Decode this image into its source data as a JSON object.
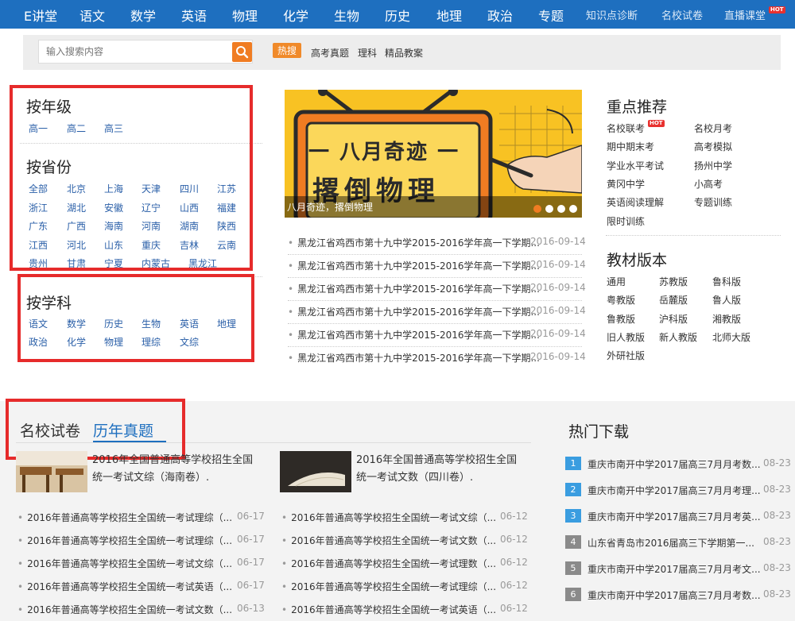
{
  "nav": {
    "brand": "E讲堂",
    "subjects": [
      "语文",
      "数学",
      "英语",
      "物理",
      "化学",
      "生物",
      "历史",
      "地理",
      "政治",
      "专题"
    ],
    "extras": [
      "知识点诊断",
      "名校试卷",
      "直播课堂"
    ],
    "hot_badge": "HOT"
  },
  "search": {
    "placeholder": "输入搜索内容",
    "hot_label": "热搜",
    "hot_links": [
      "高考真题",
      "理科",
      "精品教案"
    ]
  },
  "by_grade": {
    "title": "按年级",
    "items": [
      "高一",
      "高二",
      "高三"
    ]
  },
  "by_province": {
    "title": "按省份",
    "items": [
      "全部",
      "北京",
      "上海",
      "天津",
      "四川",
      "江苏",
      "浙江",
      "湖北",
      "安徽",
      "辽宁",
      "山西",
      "福建",
      "广东",
      "广西",
      "海南",
      "河南",
      "湖南",
      "陕西",
      "江西",
      "河北",
      "山东",
      "重庆",
      "吉林",
      "云南",
      "贵州",
      "甘肃",
      "宁夏",
      "内蒙古",
      "黑龙江"
    ]
  },
  "by_subject": {
    "title": "按学科",
    "items": [
      "语文",
      "数学",
      "历史",
      "生物",
      "英语",
      "地理",
      "政治",
      "化学",
      "物理",
      "理综",
      "文综"
    ]
  },
  "banner": {
    "headline": "一 八月奇迹 一",
    "subhead": "撂倒物理",
    "caption": "八月奇迹，撂倒物理"
  },
  "news": {
    "items": [
      {
        "title": "黑龙江省鸡西市第十九中学2015-2016学年高一下学期...",
        "date": "2016-09-14"
      },
      {
        "title": "黑龙江省鸡西市第十九中学2015-2016学年高一下学期...",
        "date": "2016-09-14"
      },
      {
        "title": "黑龙江省鸡西市第十九中学2015-2016学年高一下学期...",
        "date": "2016-09-14"
      },
      {
        "title": "黑龙江省鸡西市第十九中学2015-2016学年高一下学期...",
        "date": "2016-09-14"
      },
      {
        "title": "黑龙江省鸡西市第十九中学2015-2016学年高一下学期...",
        "date": "2016-09-14"
      },
      {
        "title": "黑龙江省鸡西市第十九中学2015-2016学年高一下学期...",
        "date": "2016-09-14"
      }
    ]
  },
  "recommend": {
    "title": "重点推荐",
    "hot_badge": "HOT",
    "items": [
      "名校联考",
      "名校月考",
      "期中期末考",
      "高考模拟",
      "学业水平考试",
      "扬州中学",
      "黄冈中学",
      "小高考",
      "英语阅读理解",
      "专题训练",
      "限时训练"
    ]
  },
  "textbook": {
    "title": "教材版本",
    "items": [
      "通用",
      "苏教版",
      "鲁科版",
      "粤教版",
      "岳麓版",
      "鲁人版",
      "鲁教版",
      "沪科版",
      "湘教版",
      "旧人教版",
      "新人教版",
      "北师大版",
      "外研社版"
    ]
  },
  "papers": {
    "tab_inactive": "名校试卷",
    "tab_active": "历年真题",
    "feature_left": "2016年全国普通高等学校招生全国统一考试文综（海南卷）.",
    "feature_right": "2016年全国普通高等学校招生全国统一考试文数（四川卷）.",
    "left_list": [
      {
        "title": "2016年普通高等学校招生全国统一考试理综（...",
        "date": "06-17"
      },
      {
        "title": "2016年普通高等学校招生全国统一考试理综（...",
        "date": "06-17"
      },
      {
        "title": "2016年普通高等学校招生全国统一考试文综（...",
        "date": "06-17"
      },
      {
        "title": "2016年普通高等学校招生全国统一考试英语（...",
        "date": "06-17"
      },
      {
        "title": "2016年普通高等学校招生全国统一考试文数（...",
        "date": "06-13"
      }
    ],
    "right_list": [
      {
        "title": "2016年普通高等学校招生全国统一考试文综（...",
        "date": "06-12"
      },
      {
        "title": "2016年普通高等学校招生全国统一考试文数（...",
        "date": "06-12"
      },
      {
        "title": "2016年普通高等学校招生全国统一考试理数（...",
        "date": "06-12"
      },
      {
        "title": "2016年普通高等学校招生全国统一考试理综（...",
        "date": "06-12"
      },
      {
        "title": "2016年普通高等学校招生全国统一考试英语（...",
        "date": "06-12"
      }
    ]
  },
  "downloads": {
    "title": "热门下载",
    "items": [
      {
        "num": "1",
        "title": "重庆市南开中学2017届高三7月月考数...",
        "date": "08-23"
      },
      {
        "num": "2",
        "title": "重庆市南开中学2017届高三7月月考理...",
        "date": "08-23"
      },
      {
        "num": "3",
        "title": "重庆市南开中学2017届高三7月月考英...",
        "date": "08-23"
      },
      {
        "num": "4",
        "title": "山东省青岛市2016届高三下学期第一...",
        "date": "08-23"
      },
      {
        "num": "5",
        "title": "重庆市南开中学2017届高三7月月考文...",
        "date": "08-23"
      },
      {
        "num": "6",
        "title": "重庆市南开中学2017届高三7月月考数...",
        "date": "08-23"
      }
    ],
    "colors": {
      "top": "#3a9de0",
      "rest": "#8a8a8a"
    }
  }
}
